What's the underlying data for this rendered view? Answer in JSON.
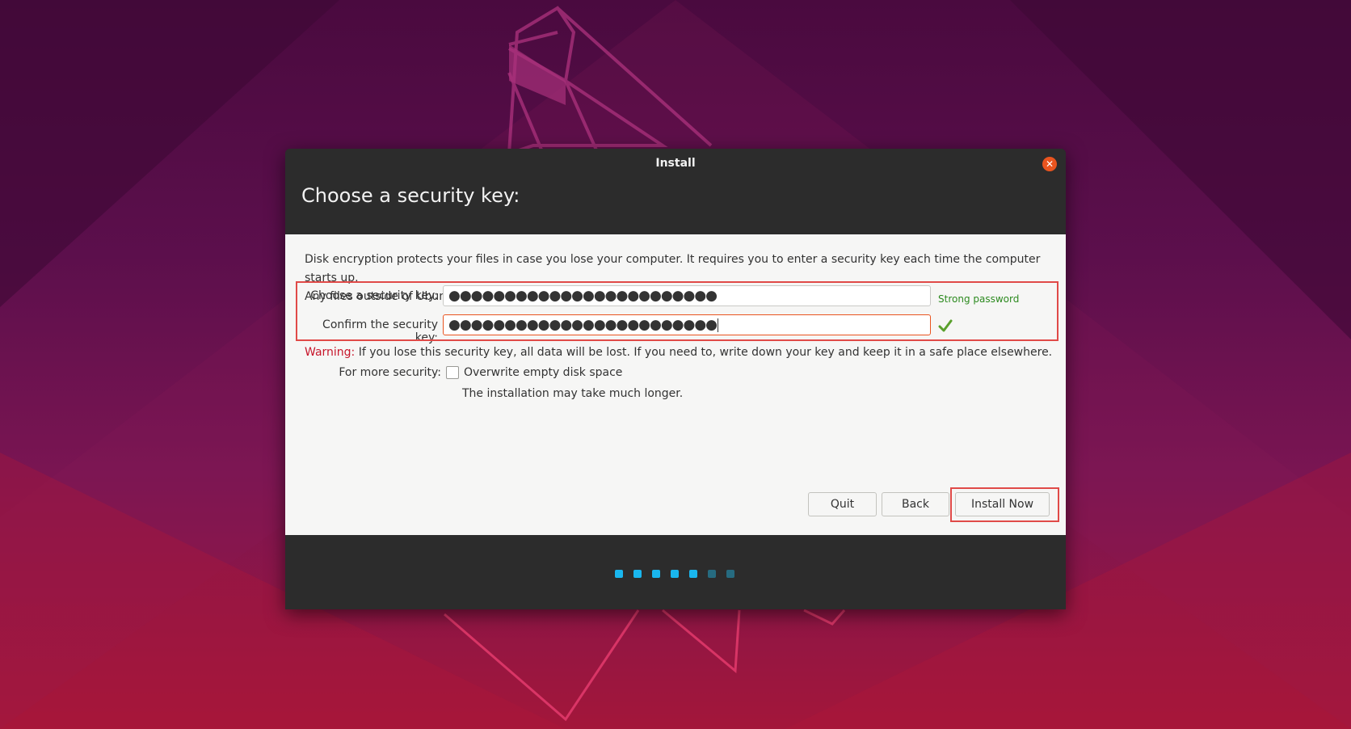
{
  "window": {
    "title": "Install",
    "close_icon": "close-icon"
  },
  "page": {
    "heading": "Choose a security key:"
  },
  "description": {
    "line1": "Disk encryption protects your files in case you lose your computer. It requires you to enter a security key each time the computer starts up.",
    "line2": "Any files outside of Ubuntu will not be encrypted."
  },
  "security_key": {
    "choose_label": "Choose a security key:",
    "choose_value": "●●●●●●●●●●●●●●●●●●●●●●●●",
    "confirm_label": "Confirm the security key:",
    "confirm_value": "●●●●●●●●●●●●●●●●●●●●●●●●",
    "strength_text": "Strong password",
    "match_icon": "checkmark-icon"
  },
  "warning": {
    "label": "Warning:",
    "text": " If you lose this security key, all data will be lost. If you need to, write down your key and keep it in a safe place elsewhere."
  },
  "security_options": {
    "label": "For more security:",
    "overwrite_label": "Overwrite empty disk space",
    "overwrite_checked": false,
    "note": "The installation may take much longer."
  },
  "buttons": {
    "quit": "Quit",
    "back": "Back",
    "install_now": "Install Now"
  },
  "progress": {
    "total_steps": 7,
    "completed_steps": 5,
    "active_color": "#19b6ee",
    "inactive_color": "#266b80"
  },
  "colors": {
    "accent": "#e95420",
    "annotation": "#e04a48",
    "strength_color": "#2c8a1f",
    "warning_color": "#c7162b"
  }
}
